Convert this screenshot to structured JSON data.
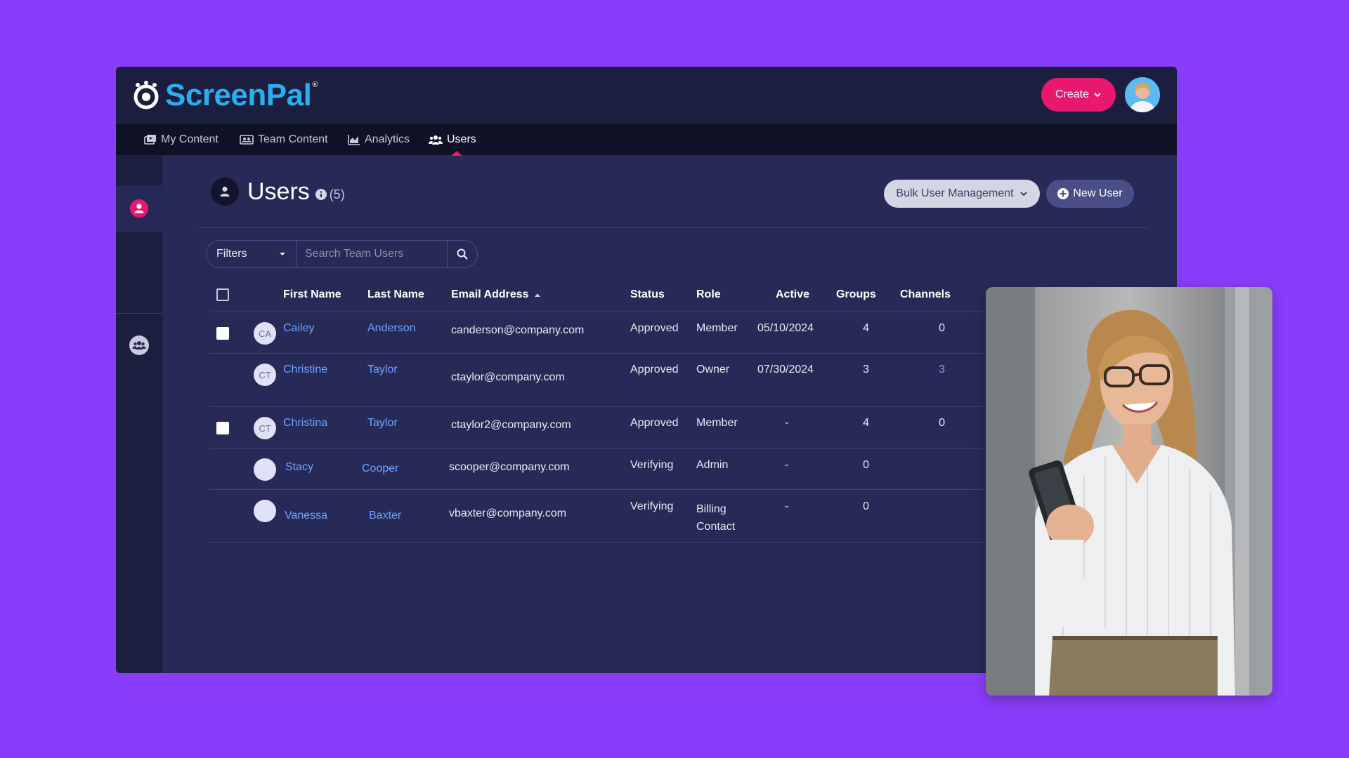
{
  "brand": {
    "name": "ScreenPal",
    "reg": "®"
  },
  "header": {
    "create_label": "Create"
  },
  "nav": [
    {
      "label": "My Content",
      "icon": "my-content-icon"
    },
    {
      "label": "Team Content",
      "icon": "team-content-icon"
    },
    {
      "label": "Analytics",
      "icon": "analytics-icon"
    },
    {
      "label": "Users",
      "icon": "users-icon",
      "active": true
    }
  ],
  "page": {
    "title": "Users",
    "count": "(5)"
  },
  "actions": {
    "bulk_label": "Bulk User Management",
    "new_user_label": "New User"
  },
  "filters": {
    "label": "Filters",
    "search_placeholder": "Search Team Users"
  },
  "table": {
    "columns": [
      "First Name",
      "Last Name",
      "Email Address",
      "Status",
      "Role",
      "Active",
      "Groups",
      "Channels"
    ],
    "sort_column": "Email Address",
    "rows": [
      {
        "checkbox": true,
        "initials": "CA",
        "first": "Cailey",
        "last": "Anderson",
        "email": "canderson@company.com",
        "status": "Approved",
        "role": "Member",
        "active": "05/10/2024",
        "groups": "4",
        "channels": "0"
      },
      {
        "checkbox": false,
        "initials": "CT",
        "first": "Christine",
        "last": "Taylor",
        "email": "ctaylor@company.com",
        "status": "Approved",
        "role": "Owner",
        "active": "07/30/2024",
        "groups": "3",
        "channels": "3"
      },
      {
        "checkbox": true,
        "initials": "CT",
        "first": "Christina",
        "last": "Taylor",
        "email": "ctaylor2@company.com",
        "status": "Approved",
        "role": "Member",
        "active": "-",
        "groups": "4",
        "channels": "0"
      },
      {
        "checkbox": false,
        "initials": "",
        "first": "Stacy",
        "last": "Cooper",
        "email": "scooper@company.com",
        "status": "Verifying",
        "role": "Admin",
        "active": "-",
        "groups": "0",
        "channels": ""
      },
      {
        "checkbox": false,
        "initials": "",
        "first": "Vanessa",
        "last": "Baxter",
        "email": "vbaxter@company.com",
        "status": "Verifying",
        "role": "Billing Contact",
        "active": "-",
        "groups": "0",
        "channels": ""
      }
    ]
  },
  "colors": {
    "background": "#8a3cfb",
    "accent": "#e8186e",
    "link": "#6fa3ff",
    "brand": "#2aaef0"
  }
}
